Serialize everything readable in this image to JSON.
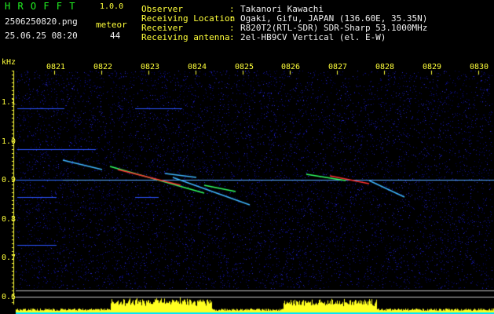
{
  "app": {
    "name": "H R O F F T",
    "version": "1.0.0",
    "filename": "2506250820.png",
    "datetime": "25.06.25 08:20",
    "meteor_label": "meteor",
    "meteor_count": "44"
  },
  "info": {
    "rows": [
      {
        "label": "Observer",
        "sep": ":",
        "value": "Takanori Kawachi"
      },
      {
        "label": "Receiving Location",
        "sep": ":",
        "value": "Ogaki, Gifu, JAPAN (136.60E, 35.35N)"
      },
      {
        "label": "Receiver",
        "sep": ":",
        "value": "R820T2(RTL-SDR) SDR-Sharp 53.1000MHz"
      },
      {
        "label": "Receiving antenna",
        "sep": ":",
        "value": "2el-HB9CV Vertical (el. E-W)"
      }
    ]
  },
  "axis": {
    "unit": "kHz",
    "time_ticks": [
      "0821",
      "0822",
      "0823",
      "0824",
      "0825",
      "0826",
      "0827",
      "0828",
      "0829",
      "0830"
    ],
    "freq_ticks": [
      "1.1",
      "1.0",
      "0.9",
      "0.8",
      "0.7",
      "0.6"
    ]
  },
  "colors": {
    "background": "#000000",
    "noise": "#0a0a8c",
    "carrier": "#55a8ff",
    "meteor_hot": "#ff3030",
    "meteor_mid": "#30ff60",
    "bars": "#ffff20",
    "baseline": "#00e5ff",
    "header_green": "#21f221",
    "header_yellow": "#ffff3a"
  }
}
